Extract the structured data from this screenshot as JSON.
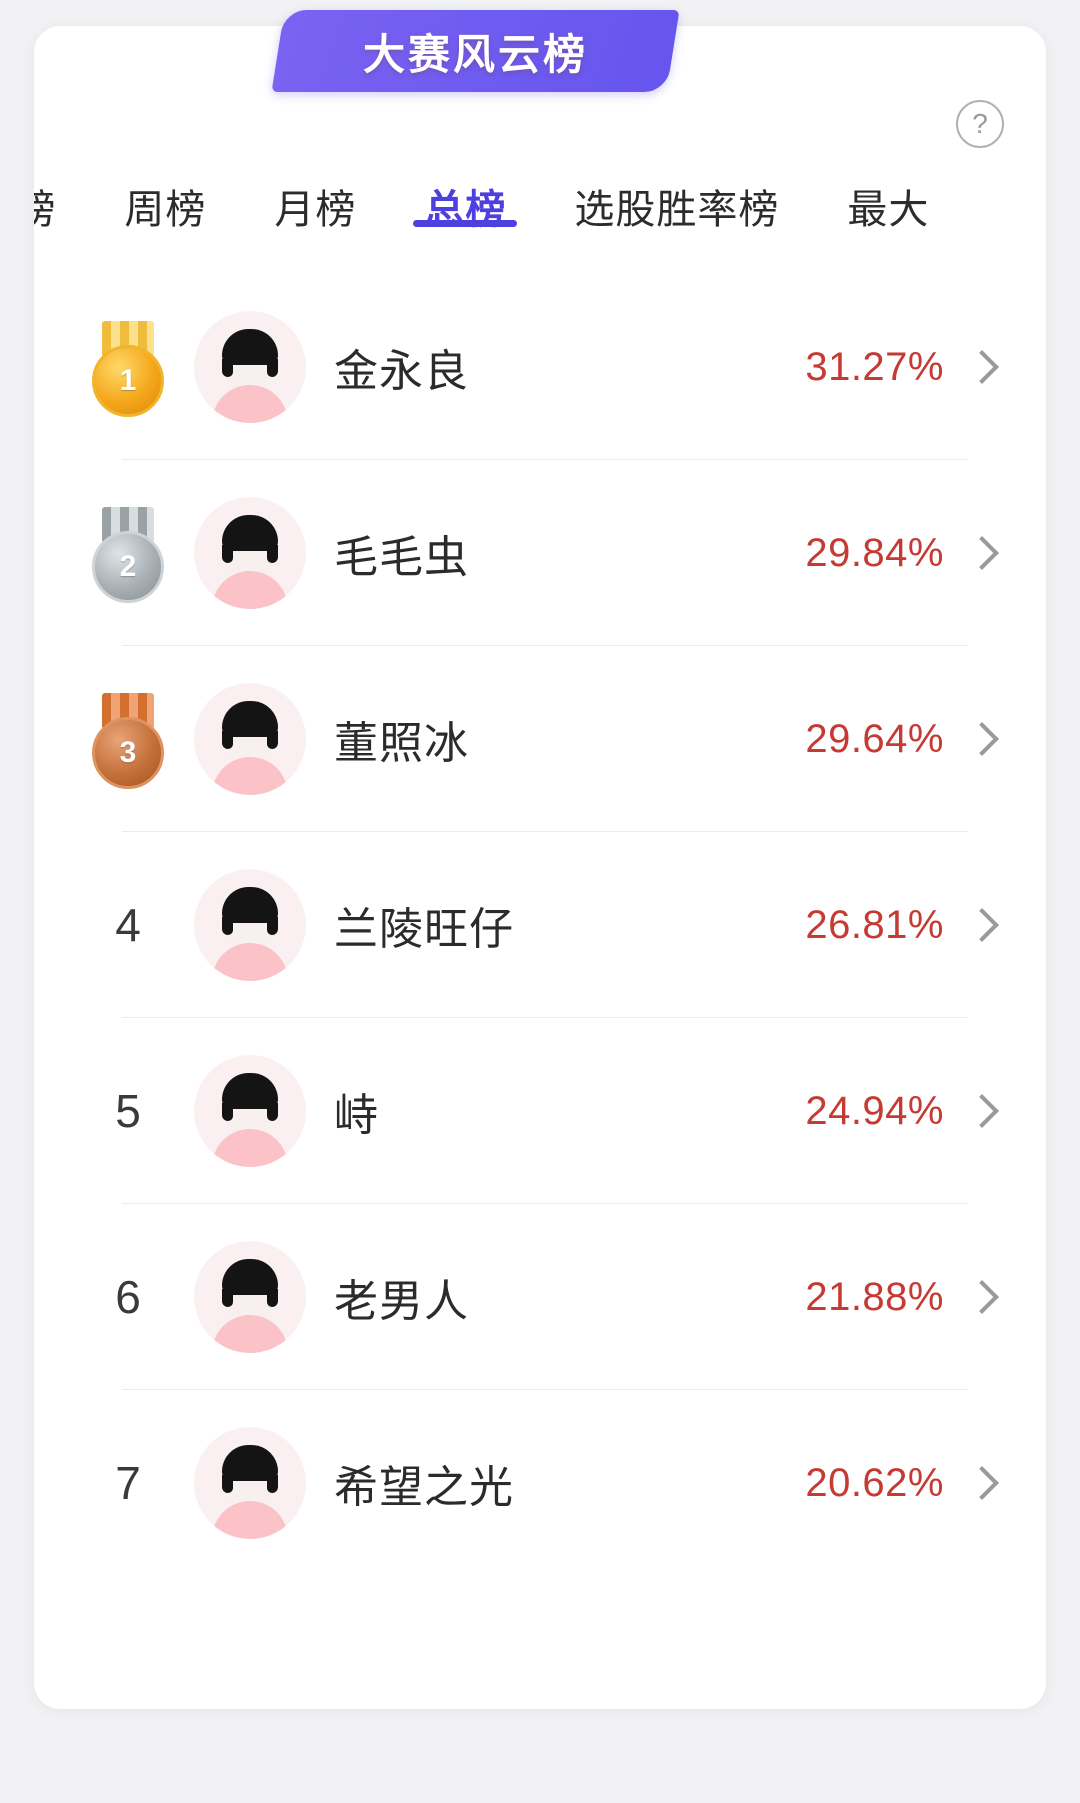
{
  "header": {
    "title": "大赛风云榜",
    "help_icon": "question-mark-icon",
    "help_label": "?",
    "banner_color": "#6f5cf0"
  },
  "tabs": {
    "items": [
      {
        "label": "|榜",
        "active": false,
        "truncated": true
      },
      {
        "label": "周榜",
        "active": false
      },
      {
        "label": "月榜",
        "active": false
      },
      {
        "label": "总榜",
        "active": true
      },
      {
        "label": "选股胜率榜",
        "active": false
      },
      {
        "label": "最大",
        "active": false,
        "truncated": true
      }
    ],
    "active_color": "#4d3fe0",
    "inactive_color": "#2c2c2c"
  },
  "ranking": {
    "value_color": "#c53a32",
    "rows": [
      {
        "rank": "1",
        "badge": "gold-medal-icon",
        "name": "金永良",
        "value": "31.27%"
      },
      {
        "rank": "2",
        "badge": "silver-medal-icon",
        "name": "毛毛虫",
        "value": "29.84%"
      },
      {
        "rank": "3",
        "badge": "bronze-medal-icon",
        "name": "董照冰",
        "value": "29.64%"
      },
      {
        "rank": "4",
        "badge": "number",
        "name": "兰陵旺仔",
        "value": "26.81%"
      },
      {
        "rank": "5",
        "badge": "number",
        "name": "峙",
        "value": "24.94%"
      },
      {
        "rank": "6",
        "badge": "number",
        "name": "老男人",
        "value": "21.88%"
      },
      {
        "rank": "7",
        "badge": "number",
        "name": "希望之光",
        "value": "20.62%"
      }
    ]
  }
}
